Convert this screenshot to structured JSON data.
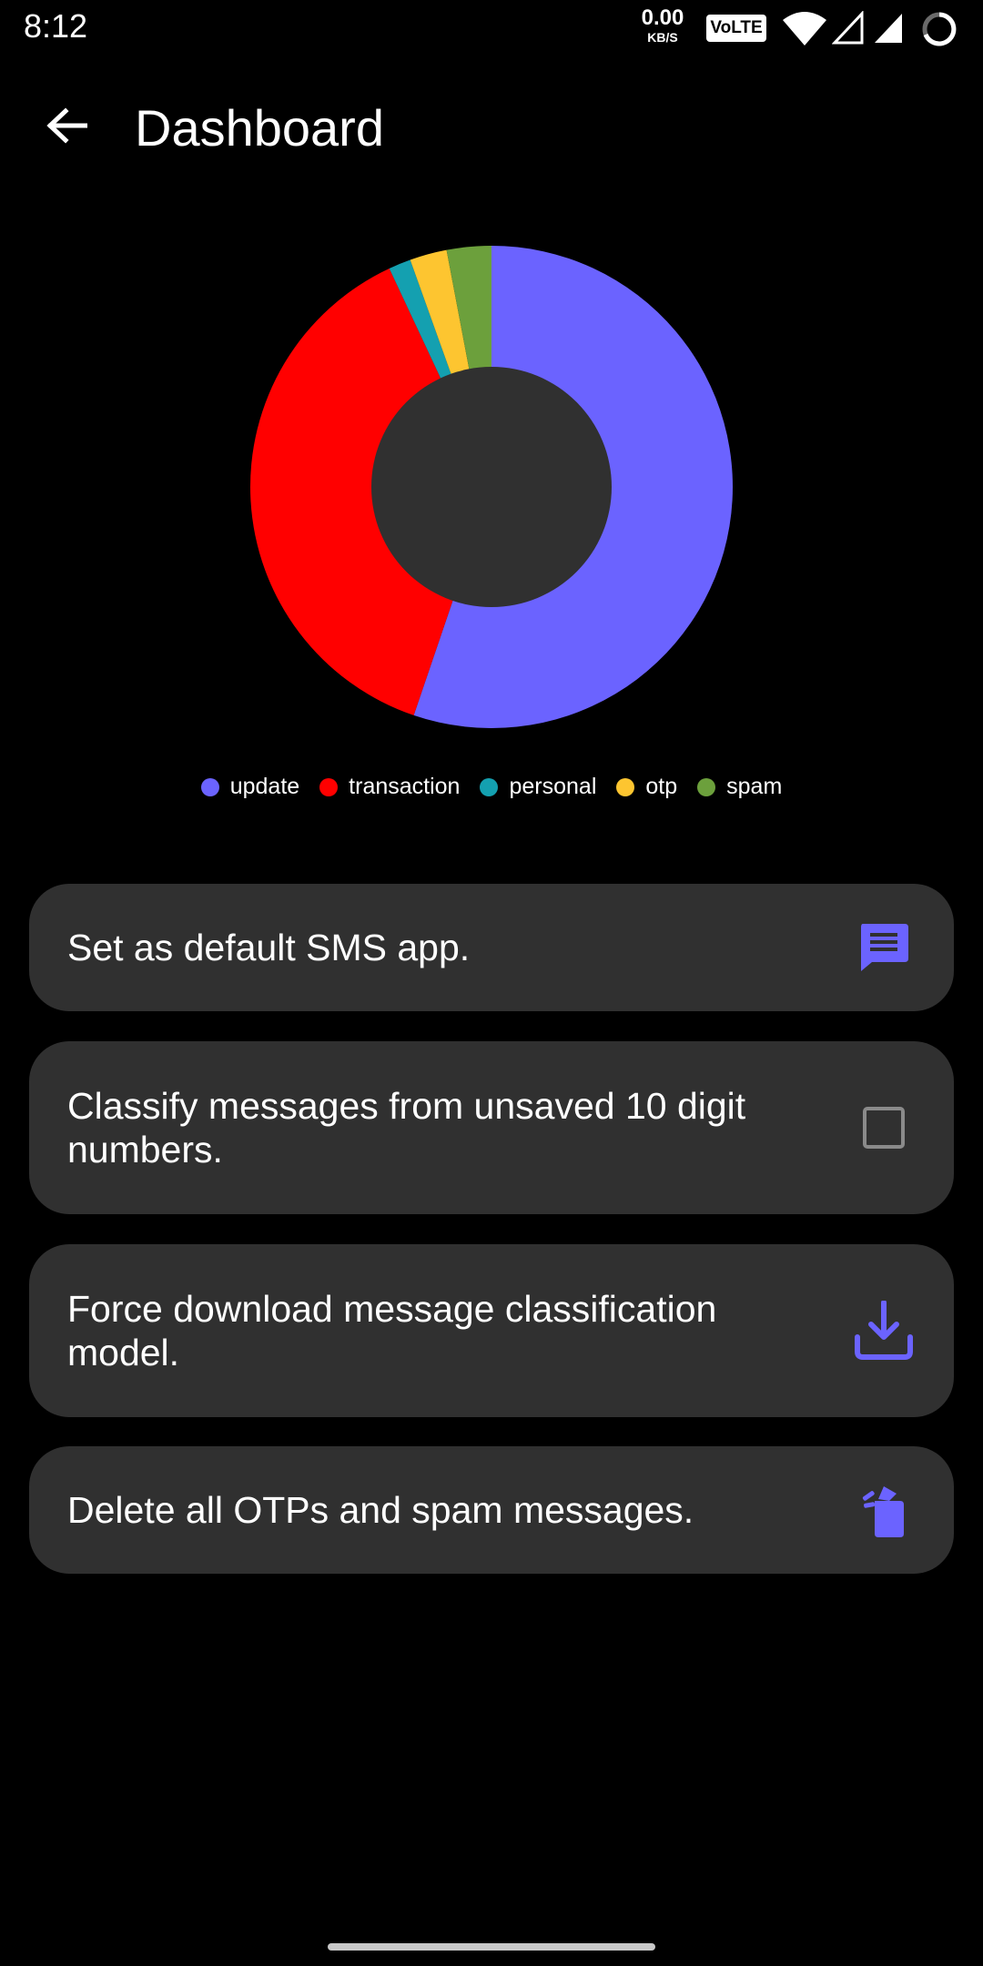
{
  "status_bar": {
    "time": "8:12",
    "net_speed_value": "0.00",
    "net_speed_unit": "KB/S",
    "volte": "VoLTE"
  },
  "app_bar": {
    "title": "Dashboard",
    "back_icon": "arrow-back-icon"
  },
  "chart_data": {
    "type": "pie",
    "donut": true,
    "categories": [
      "update",
      "transaction",
      "personal",
      "otp",
      "spam"
    ],
    "values": [
      55.5,
      38.0,
      1.5,
      2.5,
      3.0
    ],
    "colors": [
      "#6b63ff",
      "#ff0000",
      "#14a0b0",
      "#fdc530",
      "#6ca03c"
    ],
    "legend_position": "bottom",
    "hole_color": "#303030"
  },
  "actions": [
    {
      "label": "Set as default SMS app.",
      "icon": "message-icon"
    },
    {
      "label": "Classify messages from unsaved 10 digit numbers.",
      "icon": "checkbox-icon",
      "checked": false
    },
    {
      "label": "Force download message classification model.",
      "icon": "download-icon"
    },
    {
      "label": "Delete all OTPs and spam messages.",
      "icon": "clean-icon"
    }
  ],
  "colors": {
    "accent": "#6b63ff",
    "background": "#000000",
    "card": "#303030"
  }
}
